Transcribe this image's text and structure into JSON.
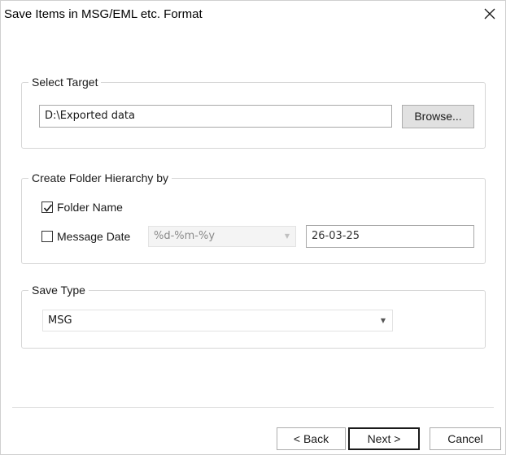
{
  "window": {
    "title": "Save Items in MSG/EML etc. Format"
  },
  "select_target": {
    "legend": "Select Target",
    "path_value": "D:\\Exported data",
    "browse_label": "Browse..."
  },
  "folder_hierarchy": {
    "legend": "Create Folder Hierarchy by",
    "folder_name": {
      "label": "Folder Name",
      "checked": true
    },
    "message_date": {
      "label": "Message Date",
      "checked": false
    },
    "date_format_value": "%d-%m-%y",
    "date_value": "26-03-25"
  },
  "save_type": {
    "legend": "Save Type",
    "selected": "MSG"
  },
  "footer": {
    "back_label": "< Back",
    "next_label": "Next >",
    "cancel_label": "Cancel"
  }
}
